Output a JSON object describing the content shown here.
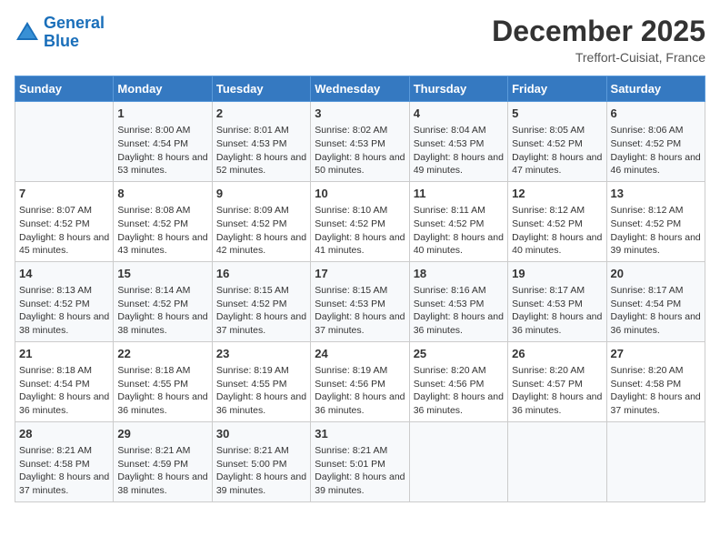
{
  "logo": {
    "line1": "General",
    "line2": "Blue"
  },
  "title": "December 2025",
  "subtitle": "Treffort-Cuisiat, France",
  "weekdays": [
    "Sunday",
    "Monday",
    "Tuesday",
    "Wednesday",
    "Thursday",
    "Friday",
    "Saturday"
  ],
  "weeks": [
    [
      {
        "day": "",
        "sunrise": "",
        "sunset": "",
        "daylight": ""
      },
      {
        "day": "1",
        "sunrise": "Sunrise: 8:00 AM",
        "sunset": "Sunset: 4:54 PM",
        "daylight": "Daylight: 8 hours and 53 minutes."
      },
      {
        "day": "2",
        "sunrise": "Sunrise: 8:01 AM",
        "sunset": "Sunset: 4:53 PM",
        "daylight": "Daylight: 8 hours and 52 minutes."
      },
      {
        "day": "3",
        "sunrise": "Sunrise: 8:02 AM",
        "sunset": "Sunset: 4:53 PM",
        "daylight": "Daylight: 8 hours and 50 minutes."
      },
      {
        "day": "4",
        "sunrise": "Sunrise: 8:04 AM",
        "sunset": "Sunset: 4:53 PM",
        "daylight": "Daylight: 8 hours and 49 minutes."
      },
      {
        "day": "5",
        "sunrise": "Sunrise: 8:05 AM",
        "sunset": "Sunset: 4:52 PM",
        "daylight": "Daylight: 8 hours and 47 minutes."
      },
      {
        "day": "6",
        "sunrise": "Sunrise: 8:06 AM",
        "sunset": "Sunset: 4:52 PM",
        "daylight": "Daylight: 8 hours and 46 minutes."
      }
    ],
    [
      {
        "day": "7",
        "sunrise": "Sunrise: 8:07 AM",
        "sunset": "Sunset: 4:52 PM",
        "daylight": "Daylight: 8 hours and 45 minutes."
      },
      {
        "day": "8",
        "sunrise": "Sunrise: 8:08 AM",
        "sunset": "Sunset: 4:52 PM",
        "daylight": "Daylight: 8 hours and 43 minutes."
      },
      {
        "day": "9",
        "sunrise": "Sunrise: 8:09 AM",
        "sunset": "Sunset: 4:52 PM",
        "daylight": "Daylight: 8 hours and 42 minutes."
      },
      {
        "day": "10",
        "sunrise": "Sunrise: 8:10 AM",
        "sunset": "Sunset: 4:52 PM",
        "daylight": "Daylight: 8 hours and 41 minutes."
      },
      {
        "day": "11",
        "sunrise": "Sunrise: 8:11 AM",
        "sunset": "Sunset: 4:52 PM",
        "daylight": "Daylight: 8 hours and 40 minutes."
      },
      {
        "day": "12",
        "sunrise": "Sunrise: 8:12 AM",
        "sunset": "Sunset: 4:52 PM",
        "daylight": "Daylight: 8 hours and 40 minutes."
      },
      {
        "day": "13",
        "sunrise": "Sunrise: 8:12 AM",
        "sunset": "Sunset: 4:52 PM",
        "daylight": "Daylight: 8 hours and 39 minutes."
      }
    ],
    [
      {
        "day": "14",
        "sunrise": "Sunrise: 8:13 AM",
        "sunset": "Sunset: 4:52 PM",
        "daylight": "Daylight: 8 hours and 38 minutes."
      },
      {
        "day": "15",
        "sunrise": "Sunrise: 8:14 AM",
        "sunset": "Sunset: 4:52 PM",
        "daylight": "Daylight: 8 hours and 38 minutes."
      },
      {
        "day": "16",
        "sunrise": "Sunrise: 8:15 AM",
        "sunset": "Sunset: 4:52 PM",
        "daylight": "Daylight: 8 hours and 37 minutes."
      },
      {
        "day": "17",
        "sunrise": "Sunrise: 8:15 AM",
        "sunset": "Sunset: 4:53 PM",
        "daylight": "Daylight: 8 hours and 37 minutes."
      },
      {
        "day": "18",
        "sunrise": "Sunrise: 8:16 AM",
        "sunset": "Sunset: 4:53 PM",
        "daylight": "Daylight: 8 hours and 36 minutes."
      },
      {
        "day": "19",
        "sunrise": "Sunrise: 8:17 AM",
        "sunset": "Sunset: 4:53 PM",
        "daylight": "Daylight: 8 hours and 36 minutes."
      },
      {
        "day": "20",
        "sunrise": "Sunrise: 8:17 AM",
        "sunset": "Sunset: 4:54 PM",
        "daylight": "Daylight: 8 hours and 36 minutes."
      }
    ],
    [
      {
        "day": "21",
        "sunrise": "Sunrise: 8:18 AM",
        "sunset": "Sunset: 4:54 PM",
        "daylight": "Daylight: 8 hours and 36 minutes."
      },
      {
        "day": "22",
        "sunrise": "Sunrise: 8:18 AM",
        "sunset": "Sunset: 4:55 PM",
        "daylight": "Daylight: 8 hours and 36 minutes."
      },
      {
        "day": "23",
        "sunrise": "Sunrise: 8:19 AM",
        "sunset": "Sunset: 4:55 PM",
        "daylight": "Daylight: 8 hours and 36 minutes."
      },
      {
        "day": "24",
        "sunrise": "Sunrise: 8:19 AM",
        "sunset": "Sunset: 4:56 PM",
        "daylight": "Daylight: 8 hours and 36 minutes."
      },
      {
        "day": "25",
        "sunrise": "Sunrise: 8:20 AM",
        "sunset": "Sunset: 4:56 PM",
        "daylight": "Daylight: 8 hours and 36 minutes."
      },
      {
        "day": "26",
        "sunrise": "Sunrise: 8:20 AM",
        "sunset": "Sunset: 4:57 PM",
        "daylight": "Daylight: 8 hours and 36 minutes."
      },
      {
        "day": "27",
        "sunrise": "Sunrise: 8:20 AM",
        "sunset": "Sunset: 4:58 PM",
        "daylight": "Daylight: 8 hours and 37 minutes."
      }
    ],
    [
      {
        "day": "28",
        "sunrise": "Sunrise: 8:21 AM",
        "sunset": "Sunset: 4:58 PM",
        "daylight": "Daylight: 8 hours and 37 minutes."
      },
      {
        "day": "29",
        "sunrise": "Sunrise: 8:21 AM",
        "sunset": "Sunset: 4:59 PM",
        "daylight": "Daylight: 8 hours and 38 minutes."
      },
      {
        "day": "30",
        "sunrise": "Sunrise: 8:21 AM",
        "sunset": "Sunset: 5:00 PM",
        "daylight": "Daylight: 8 hours and 39 minutes."
      },
      {
        "day": "31",
        "sunrise": "Sunrise: 8:21 AM",
        "sunset": "Sunset: 5:01 PM",
        "daylight": "Daylight: 8 hours and 39 minutes."
      },
      {
        "day": "",
        "sunrise": "",
        "sunset": "",
        "daylight": ""
      },
      {
        "day": "",
        "sunrise": "",
        "sunset": "",
        "daylight": ""
      },
      {
        "day": "",
        "sunrise": "",
        "sunset": "",
        "daylight": ""
      }
    ]
  ]
}
